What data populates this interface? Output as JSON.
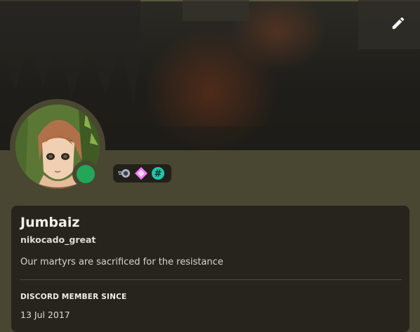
{
  "profile": {
    "display_name": "Jumbaiz",
    "username": "nikocado_great",
    "bio": "Our martyrs are sacrificed for the resistance",
    "status": "online",
    "status_color": "#23a55a"
  },
  "badges": [
    {
      "icon": "nitro-badge-icon"
    },
    {
      "icon": "hypesquad-badge-icon"
    },
    {
      "icon": "hashtag-badge-icon"
    }
  ],
  "member_since": {
    "title": "DISCORD MEMBER SINCE",
    "date": "13 Jul 2017"
  },
  "colors": {
    "background": "#494631",
    "card": "#27241d",
    "accent_green": "#23a55a"
  }
}
